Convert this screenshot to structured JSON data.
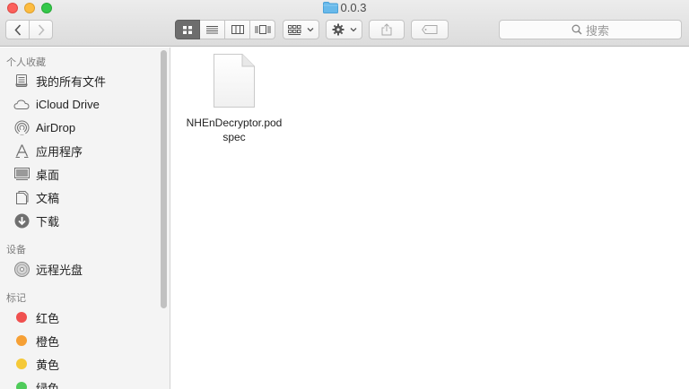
{
  "window": {
    "title": "0.0.3"
  },
  "toolbar": {
    "back_label": "‹",
    "forward_label": "›",
    "view_modes": [
      "icon-view",
      "list-view",
      "column-view",
      "coverflow-view"
    ],
    "search_placeholder": "搜索"
  },
  "sidebar": {
    "favorites_header": "个人收藏",
    "favorites": [
      {
        "label": "我的所有文件",
        "icon": "all-files-icon"
      },
      {
        "label": "iCloud Drive",
        "icon": "cloud-icon"
      },
      {
        "label": "AirDrop",
        "icon": "airdrop-icon"
      },
      {
        "label": "应用程序",
        "icon": "applications-icon"
      },
      {
        "label": "桌面",
        "icon": "desktop-icon"
      },
      {
        "label": "文稿",
        "icon": "documents-icon"
      },
      {
        "label": "下载",
        "icon": "downloads-icon"
      }
    ],
    "devices_header": "设备",
    "devices": [
      {
        "label": "远程光盘",
        "icon": "disc-icon"
      }
    ],
    "tags_header": "标记",
    "tags": [
      {
        "label": "红色",
        "color": "#f0504f"
      },
      {
        "label": "橙色",
        "color": "#f6a035"
      },
      {
        "label": "黄色",
        "color": "#f5c937"
      },
      {
        "label": "绿色",
        "color": "#4fcb5a"
      }
    ]
  },
  "content": {
    "files": [
      {
        "name": "NHEnDecryptor.podspec",
        "icon": "document-icon"
      }
    ]
  }
}
